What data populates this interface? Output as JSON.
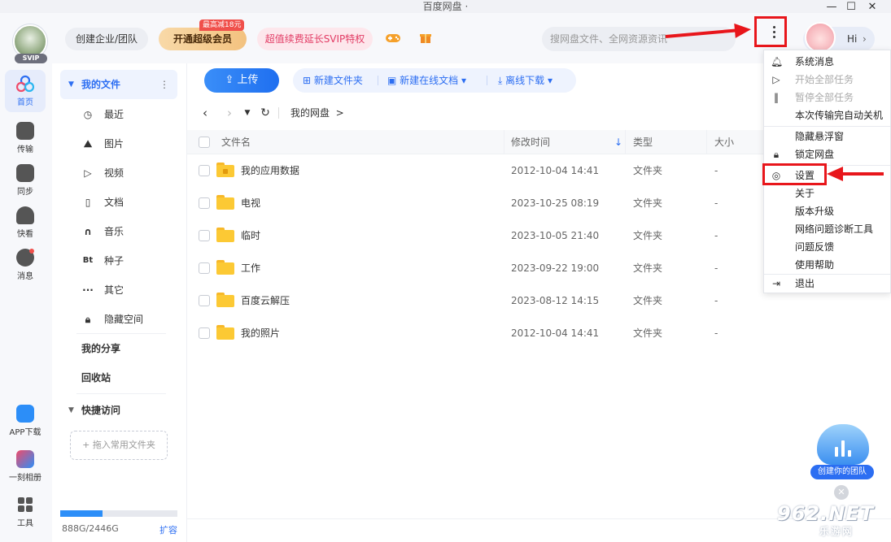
{
  "window": {
    "title": "百度网盘 ·"
  },
  "header": {
    "svip_tag": "SVIP",
    "team_btn": "创建企业/团队",
    "vip_btn": "开通超级会员",
    "promo_badge": "最高减18元",
    "svip_btn": "超值续费延长SVIP特权",
    "search_placeholder": "搜网盘文件、全网资源资讯",
    "hi_label": "Hi",
    "icons": [
      "gamepad-icon",
      "gift-icon",
      "more-vertical-icon"
    ]
  },
  "rail": [
    {
      "label": "首页",
      "active": true
    },
    {
      "label": "传输"
    },
    {
      "label": "同步"
    },
    {
      "label": "快看"
    },
    {
      "label": "消息"
    },
    {
      "label": "APP下载"
    },
    {
      "label": "一刻相册"
    },
    {
      "label": "工具"
    }
  ],
  "sidebar": {
    "head": "我的文件",
    "items": [
      "最近",
      "图片",
      "视频",
      "文档",
      "音乐",
      "种子",
      "其它",
      "隐藏空间"
    ],
    "torrent_icon": "Bt",
    "share": "我的分享",
    "recycle": "回收站",
    "quick": "快捷访问",
    "dropzone": "+ 拖入常用文件夹",
    "quota": "888G/2446G",
    "quota_used_fraction": 0.363,
    "expand": "扩容"
  },
  "toolbar": {
    "upload": "上传",
    "new_folder": "新建文件夹",
    "new_doc": "新建在线文档",
    "offline": "离线下载"
  },
  "nav": {
    "breadcrumb": "我的网盘",
    "crumb_sep": ">"
  },
  "table": {
    "headers": {
      "name": "文件名",
      "mtime": "修改时间",
      "type": "类型",
      "size": "大小"
    },
    "rows": [
      {
        "name": "我的应用数据",
        "mtime": "2012-10-04 14:41",
        "type": "文件夹",
        "size": "-",
        "locked": true
      },
      {
        "name": "电视",
        "mtime": "2023-10-25 08:19",
        "type": "文件夹",
        "size": "-"
      },
      {
        "name": "临时",
        "mtime": "2023-10-05 21:40",
        "type": "文件夹",
        "size": "-"
      },
      {
        "name": "工作",
        "mtime": "2023-09-22 19:00",
        "type": "文件夹",
        "size": "-"
      },
      {
        "name": "百度云解压",
        "mtime": "2023-08-12 14:15",
        "type": "文件夹",
        "size": "-"
      },
      {
        "name": "我的照片",
        "mtime": "2012-10-04 14:41",
        "type": "文件夹",
        "size": "-"
      }
    ]
  },
  "menu": {
    "items": [
      {
        "label": "系统消息",
        "icon": "bell-icon"
      },
      {
        "label": "开始全部任务",
        "icon": "play-icon",
        "disabled": true
      },
      {
        "label": "暂停全部任务",
        "icon": "pause-icon",
        "disabled": true
      },
      {
        "label": "本次传输完自动关机",
        "icon": ""
      },
      {
        "label": "隐藏悬浮窗",
        "icon": ""
      },
      {
        "label": "锁定网盘",
        "icon": "lock-icon"
      },
      {
        "label": "设置",
        "icon": "settings-icon"
      },
      {
        "label": "关于",
        "icon": ""
      },
      {
        "label": "版本升级",
        "icon": ""
      },
      {
        "label": "网络问题诊断工具",
        "icon": ""
      },
      {
        "label": "问题反馈",
        "icon": ""
      },
      {
        "label": "使用帮助",
        "icon": ""
      },
      {
        "label": "退出",
        "icon": "exit-icon"
      }
    ]
  },
  "widget": {
    "label": "创建你的团队"
  },
  "watermark": {
    "main": "962.NET",
    "sub": "乐游网"
  },
  "colors": {
    "accent": "#2c6ef2",
    "annotation": "#e8161b",
    "folder": "#fcc934"
  }
}
